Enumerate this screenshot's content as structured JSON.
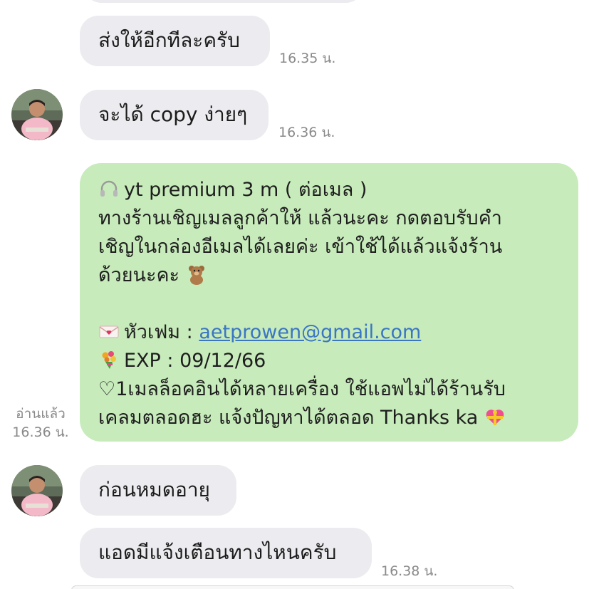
{
  "messages": {
    "m1": {
      "text": "ส่งให้อีกทีละครับ",
      "time": "16.35 น."
    },
    "m2": {
      "text": "จะได้ copy ง่ายๆ",
      "time": "16.36 น."
    },
    "green": {
      "line1": "yt premium 3 m  ( ต่อเมล )",
      "line2": "ทางร้านเชิญเมลลูกค้าให้ แล้วนะคะ กดตอบรับคำ",
      "line3": "เชิญในกล่องอีเมลได้เลยค่ะ  เข้าใช้ได้แล้วแจ้งร้าน",
      "line4": "ด้วยนะคะ",
      "subject_label": "หัวเฟม : ",
      "email": "aetprowen@gmail.com",
      "exp": "EXP : 09/12/66",
      "line7": "♡1เมลล็อคอินได้หลายเครื่อง ใช้แอพไม่ได้ร้านรับ",
      "line8": "เคลมตลอดฮะ แจ้งปัญหาได้ตลอด Thanks ka",
      "read_label": "อ่านแล้ว",
      "time": "16.36 น."
    },
    "m3": {
      "text": "ก่อนหมดอายุ"
    },
    "m4": {
      "text": "แอดมีแจ้งเตือนทางไหนครับ",
      "time": "16.38 น."
    }
  },
  "icons": {
    "headphones": "headphones-icon",
    "teddy": "teddy-bear-icon",
    "love_letter": "love-letter-icon",
    "bouquet": "bouquet-icon",
    "heart_ribbon": "heart-ribbon-icon"
  },
  "colors": {
    "incoming_bubble": "#ececf0",
    "outgoing_bubble": "#c7ebbb",
    "link": "#3a76c4",
    "timestamp": "#8a8a8a"
  }
}
